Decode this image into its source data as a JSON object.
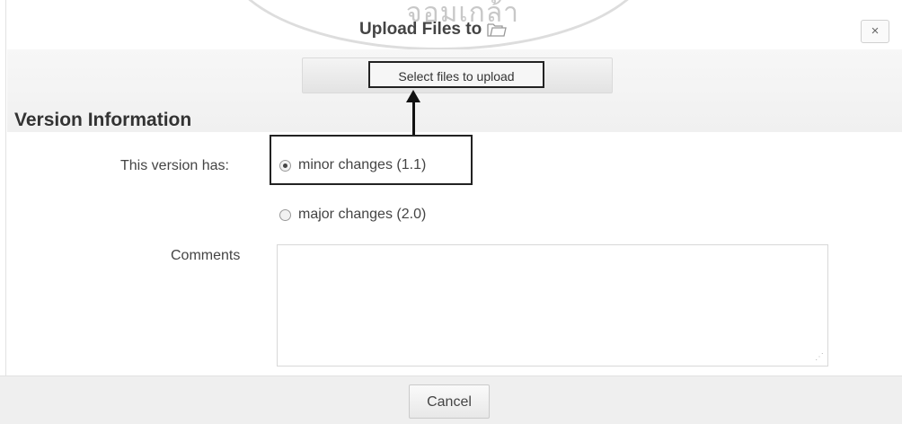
{
  "dialog": {
    "title": "Upload Files to",
    "title_icon": "folder-icon",
    "close_label": "×",
    "watermark_text": "จอมเกล้า"
  },
  "upload": {
    "select_files_label": "Select files to upload"
  },
  "version_info": {
    "heading": "Version Information",
    "label": "This version has:",
    "options": [
      {
        "label": "minor changes (1.1)",
        "checked": true
      },
      {
        "label": "major changes (2.0)",
        "checked": false
      }
    ]
  },
  "comments": {
    "label": "Comments",
    "value": ""
  },
  "footer": {
    "cancel_label": "Cancel"
  }
}
